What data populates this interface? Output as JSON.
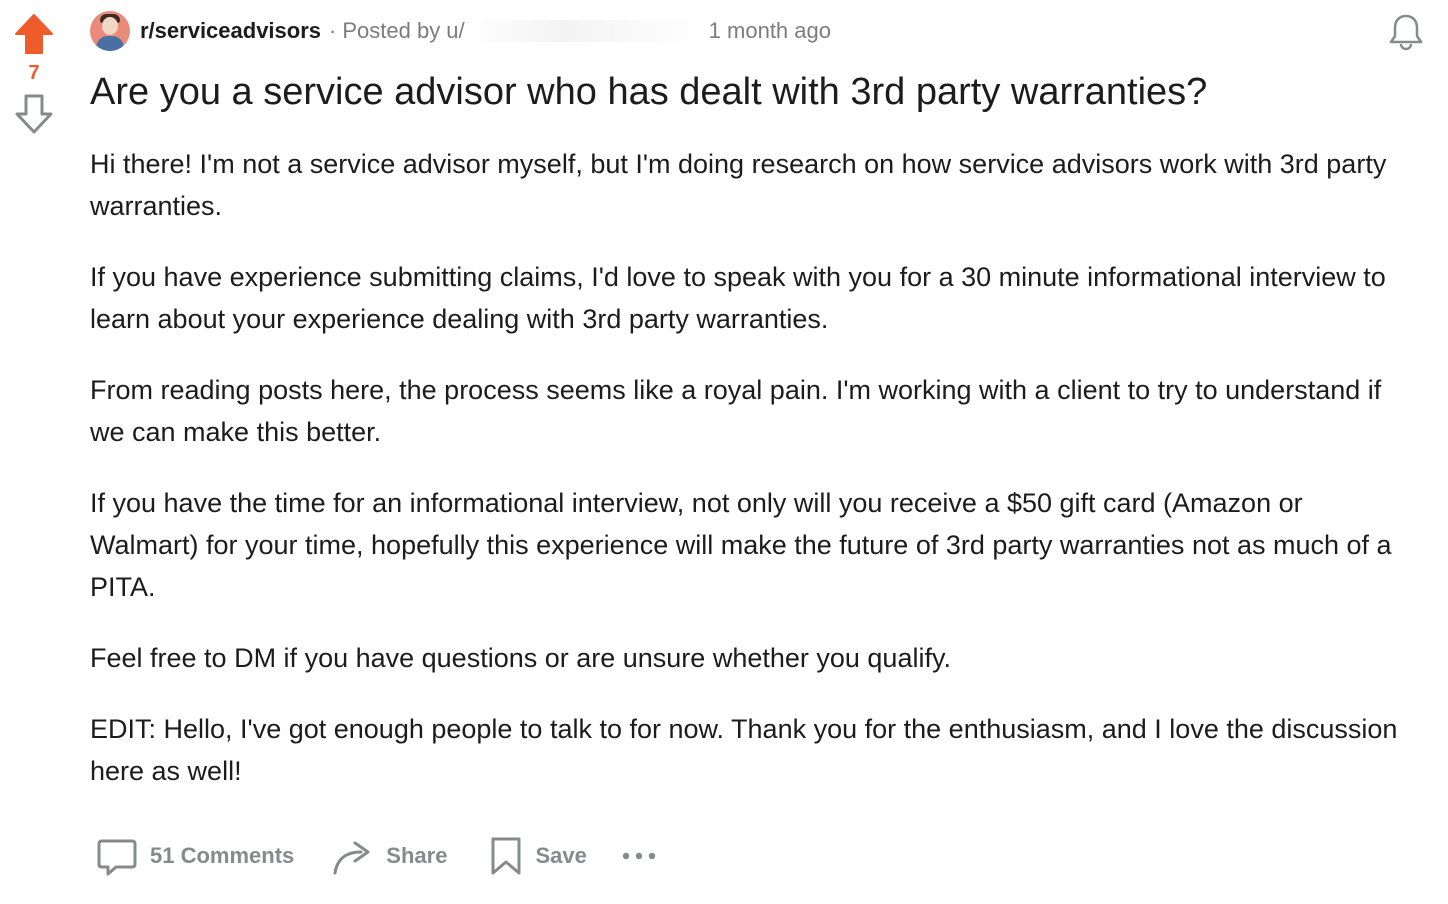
{
  "vote": {
    "count": "7",
    "upvote_color": "#ee5c2b"
  },
  "post": {
    "subreddit": "r/serviceadvisors",
    "separator": "·",
    "posted_by_prefix": "Posted by u/",
    "time": "1 month ago",
    "title": "Are you a service advisor who has dealt with 3rd party warranties?",
    "paragraphs": [
      "Hi there! I'm not a service advisor myself, but I'm doing research on how service advisors work with 3rd party warranties.",
      "If you have experience submitting claims, I'd love to speak with you for a 30 minute informational interview to learn about your experience dealing with 3rd party warranties.",
      "From reading posts here, the process seems like a royal pain. I'm working with a client to try to understand if we can make this better.",
      "If you have the time for an informational interview, not only will you receive a $50 gift card (Amazon or Walmart) for your time, hopefully this experience will make the future of 3rd party warranties not as much of a PITA.",
      "Feel free to DM if you have questions or are unsure whether you qualify.",
      "EDIT: Hello, I've got enough people to talk to for now. Thank you for the enthusiasm, and I love the discussion here as well!"
    ]
  },
  "actions": {
    "comments_label": "51 Comments",
    "share_label": "Share",
    "save_label": "Save"
  },
  "icons": {
    "upvote": "arrow-up-filled-icon",
    "downvote": "arrow-down-outline-icon",
    "bell": "bell-icon",
    "comment": "comment-bubble-icon",
    "share": "share-arrow-icon",
    "save": "bookmark-icon",
    "more": "ellipsis-icon"
  },
  "colors": {
    "text": "#1c1c1c",
    "meta": "#7c7c7c",
    "action": "#878a8c",
    "upvote": "#ee5c2b"
  }
}
